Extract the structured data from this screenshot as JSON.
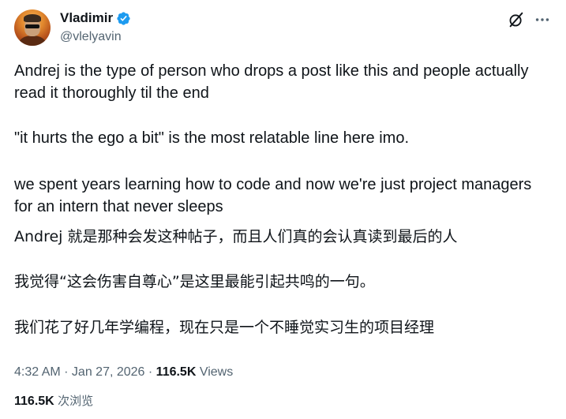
{
  "author": {
    "display_name": "Vladimir",
    "handle": "@vlelyavin",
    "verified": true
  },
  "colors": {
    "verified_badge": "#1d9bf0",
    "text_primary": "#0f1419",
    "text_secondary": "#536471"
  },
  "header_icons": {
    "grok": "grok-icon",
    "more": "more-icon"
  },
  "tweet": {
    "paragraphs": [
      "Andrej is the type of person who drops a post like this and people actually read it thoroughly til the end",
      "\"it hurts the ego a bit\" is the most relatable line here imo.",
      "we spent years learning how to code and now we're just project managers for an intern that never sleeps"
    ],
    "translation": [
      "Andrej 就是那种会发这种帖子，而且人们真的会认真读到最后的人",
      "我觉得“这会伤害自尊心”是这里最能引起共鸣的一句。",
      "我们花了好几年学编程，现在只是一个不睡觉实习生的项目经理"
    ]
  },
  "meta": {
    "time": "4:32 AM",
    "separator": " · ",
    "date": "Jan 27, 2026",
    "views_count": "116.5K",
    "views_label": "Views"
  },
  "views_translated": {
    "count": "116.5K",
    "label": "次浏览"
  }
}
